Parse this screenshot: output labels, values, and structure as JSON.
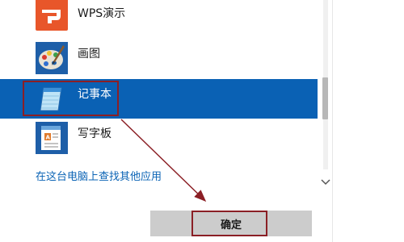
{
  "apps": [
    {
      "label": "WPS演示",
      "icon": "wps-presentation-icon",
      "selected": false
    },
    {
      "label": "画图",
      "icon": "paint-palette-icon",
      "selected": false
    },
    {
      "label": "记事本",
      "icon": "notepad-icon",
      "selected": true
    },
    {
      "label": "写字板",
      "icon": "wordpad-icon",
      "selected": false
    }
  ],
  "find_more_link": "在这台电脑上查找其他应用",
  "ok_button_label": "确定",
  "colors": {
    "selection": "#0a61b4",
    "link": "#0a63b5",
    "annotation": "#8b1f25",
    "button": "#cccccc",
    "wps_icon": "#e8562a"
  }
}
